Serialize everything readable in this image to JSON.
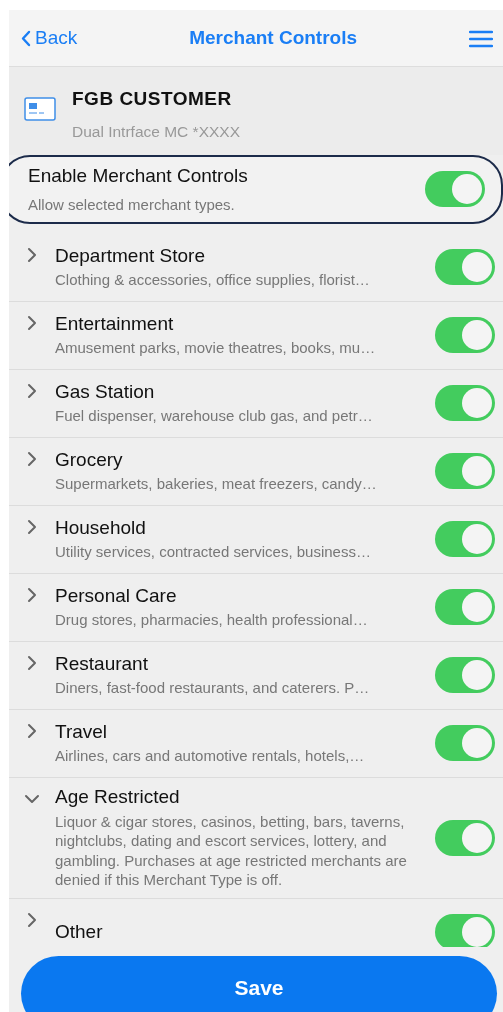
{
  "nav": {
    "back": "Back",
    "title": "Merchant Controls"
  },
  "card": {
    "name": "FGB CUSTOMER",
    "subtitle": "Dual Intrface MC *XXXX"
  },
  "master": {
    "title": "Enable Merchant Controls",
    "subtitle": "Allow selected merchant types.",
    "on": true
  },
  "categories": [
    {
      "title": "Department Store",
      "description": "Clothing & accessories, office supplies, florist…",
      "expanded": false,
      "on": true
    },
    {
      "title": "Entertainment",
      "description": "Amusement parks, movie theatres, books, mu…",
      "expanded": false,
      "on": true
    },
    {
      "title": "Gas Station",
      "description": "Fuel dispenser, warehouse club gas, and petr…",
      "expanded": false,
      "on": true
    },
    {
      "title": "Grocery",
      "description": "Supermarkets, bakeries, meat freezers, candy…",
      "expanded": false,
      "on": true
    },
    {
      "title": "Household",
      "description": "Utility services, contracted services, business…",
      "expanded": false,
      "on": true
    },
    {
      "title": "Personal Care",
      "description": "Drug stores, pharmacies, health professional…",
      "expanded": false,
      "on": true
    },
    {
      "title": "Restaurant",
      "description": "Diners, fast-food restaurants, and caterers. P…",
      "expanded": false,
      "on": true
    },
    {
      "title": "Travel",
      "description": "Airlines, cars and automotive rentals, hotels,…",
      "expanded": false,
      "on": true
    },
    {
      "title": "Age Restricted",
      "description": "Liquor & cigar stores, casinos, betting, bars, taverns, nightclubs, dating and escort services, lottery, and gambling. Purchases at age restricted merchants are denied if this Merchant Type is off.",
      "expanded": true,
      "on": true
    },
    {
      "title": "Other",
      "expanded": false,
      "on": true
    }
  ],
  "save": "Save"
}
